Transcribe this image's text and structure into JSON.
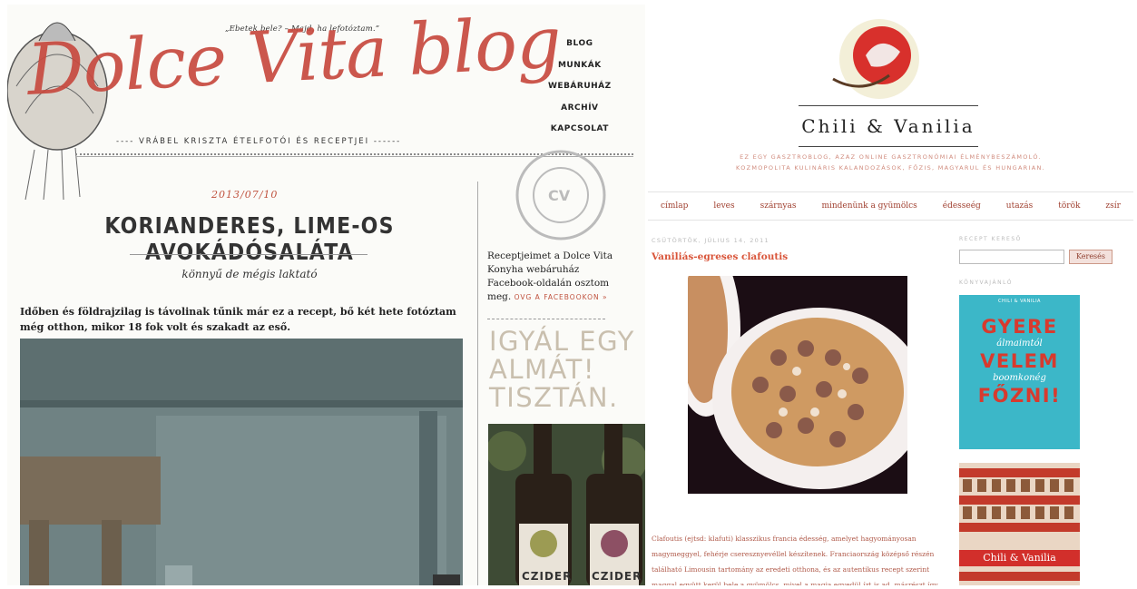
{
  "dolce_vita": {
    "quote": "„Ebetek bele? – Majd, ha lefotóztam.”",
    "logo": "Dolce Vita blog",
    "logo_sub": "---- VRÁBEL KRISZTA ÉTELFOTÓI ÉS RECEPTJEI ------",
    "nav": [
      "BLOG",
      "MUNKÁK",
      "WEBÁRUHÁZ",
      "ARCHÍV",
      "KAPCSOLAT"
    ],
    "post": {
      "date": "2013/07/10",
      "title": "KORIANDERES, LIME-OS AVOKÁDÓSALÁTA",
      "subtitle": "könnyű de mégis laktató",
      "body": "Időben és földrajzilag is távolinak tűnik már ez a recept, bő két hete fotóztam még otthon, mikor 18 fok volt és szakadt az eső."
    },
    "sidebar": {
      "text": "Receptjeimet a Dolce Vita Konyha webáruház Facebook-oldalán osztom meg.",
      "link": "OVG A FACEBOOKON »",
      "ad_text_lines": [
        "IGYÁL EGY",
        "ALMÁT!",
        "TISZTÁN."
      ],
      "bottle_label": "CZIDER"
    }
  },
  "chili_vanilia": {
    "brand": "Chili & Vanilia",
    "description": "EZ EGY GASZTROBLOG, AZAZ ONLINE GASZTRONÓMIAI ÉLMÉNYBESZÁMOLÓ. KOZMOPOLITA KULINÁRIS KALANDOZÁSOK, FŐZIS, MAGYARUL ÉS HUNGARIAN.",
    "nav": [
      "címlap",
      "leves",
      "szárnyas",
      "mindenünk a gyümölcs",
      "édesseég",
      "utazás",
      "török",
      "zsír"
    ],
    "post": {
      "date": "CSÜTÖRTÖK, JÚLIUS 14, 2011",
      "title": "Vaniliás-egreses clafoutis",
      "body": "Clafoutis (ejtsd: klafuti) klasszikus francia édesség, amelyet hagyományosan magymeggyel, fehérje cseresznyevéllel készítenek. Franciaország középső részén található Limousin tartomány az eredeti otthona, és az autentikus recept szerint maggal együtt kerül bele a gyümölcs, mivel a magja egyedül ízt is ad, másrészt így nem fő ki a"
    },
    "sidebar": {
      "search_heading": "RECEPT KERESŐ",
      "search_button": "Keresés",
      "search_placeholder": "",
      "books_heading": "KÖNYVAJÁNLÓ",
      "book": {
        "publisher": "CHILI & VANILIA",
        "lines": [
          "GYERE",
          "álmaimtól",
          "VELEM",
          "boomkonég",
          "FŐZNI!"
        ]
      },
      "shelf_badge": "Chili & Vanilia"
    }
  },
  "colors": {
    "dolce_red": "#c74a3f",
    "cv_red": "#d9553a",
    "cv_teal": "#3cb7c8"
  }
}
